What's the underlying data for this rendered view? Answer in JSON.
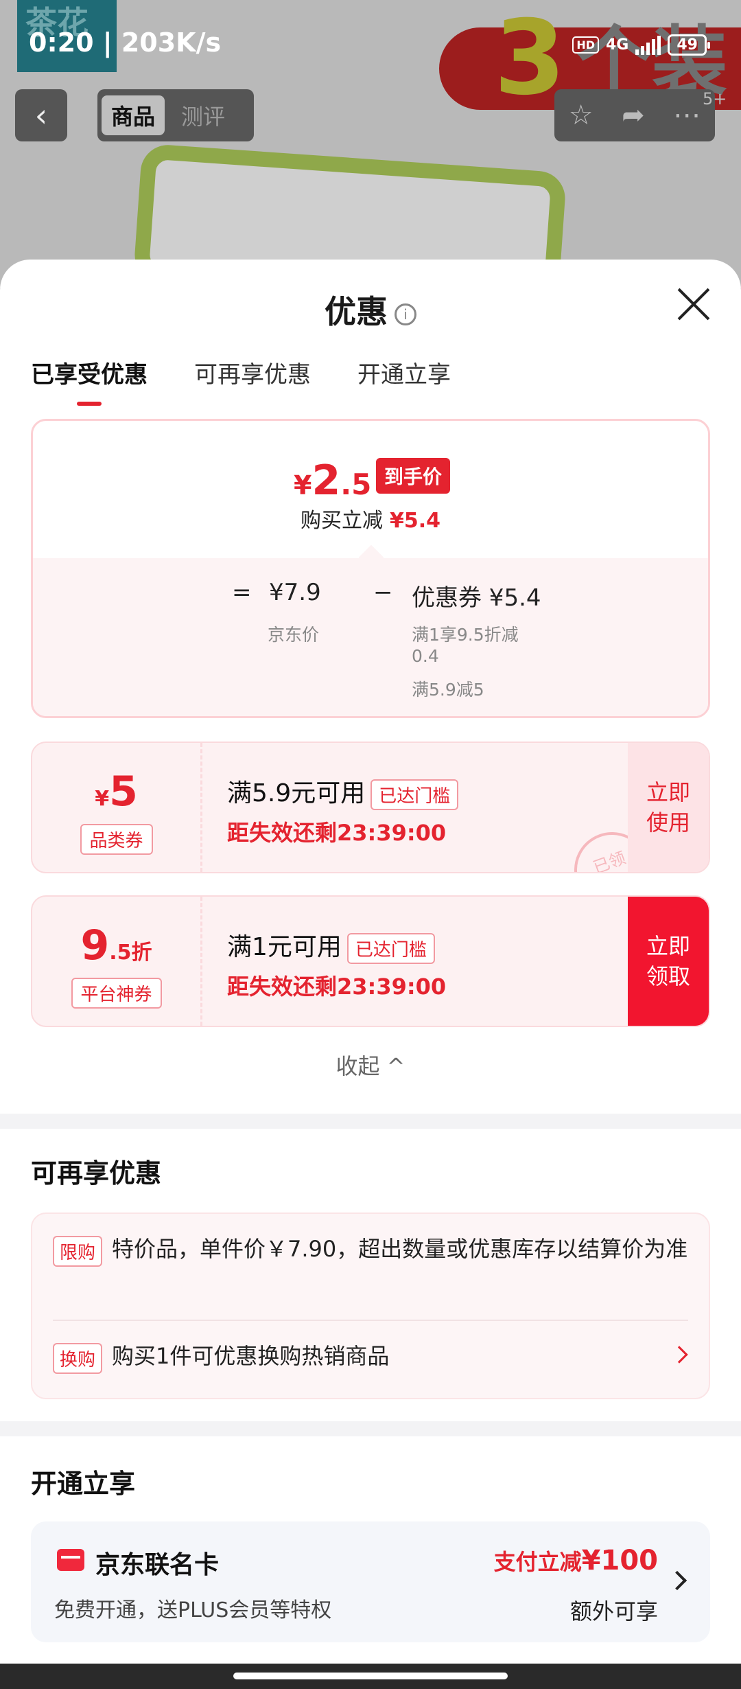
{
  "status_bar": {
    "time": "0:20 | 203K/s",
    "hd": "HD",
    "network": "4G",
    "battery": "49"
  },
  "background": {
    "brand": "茶花",
    "promo_num": "3",
    "promo_text": "个装",
    "cart_count": "5+"
  },
  "nav": {
    "back_icon": "‹",
    "tabs": [
      "商品",
      "测评"
    ]
  },
  "sheet": {
    "title": "优惠",
    "info_icon": "i",
    "tabs": [
      "已享受优惠",
      "可再享优惠",
      "开通立享"
    ],
    "price": {
      "yen": "¥",
      "int": "2",
      "dec": ".5",
      "tag": "到手价",
      "reduce_label": "购买立减",
      "reduce_value": "¥5.4"
    },
    "calc": {
      "eq": "=",
      "jd_price": "¥7.9",
      "minus": "−",
      "coupon": "优惠券 ¥5.4",
      "jd_price_label": "京东价",
      "rule1": "满1享9.5折减",
      "rule1b": "0.4",
      "rule2": "满5.9减5"
    },
    "coupons": [
      {
        "yen": "¥",
        "value": "5",
        "type": "品类券",
        "condition": "满5.9元可用",
        "condition_tag": "已达门槛",
        "expire": "距失效还剩23:39:00",
        "action": "立即使用",
        "action_l1": "立即",
        "action_l2": "使用",
        "stamp": "已领"
      },
      {
        "value": "9",
        "value_dec": ".5折",
        "type": "平台神券",
        "condition": "满1元可用",
        "condition_tag": "已达门槛",
        "expire": "距失效还剩23:39:00",
        "action_l1": "立即",
        "action_l2": "领取"
      }
    ],
    "collapse": "收起 ^",
    "more": {
      "title": "可再享优惠",
      "items": [
        {
          "tag": "限购",
          "text": "特价品，单件价￥7.90，超出数量或优惠库存以结算价为准"
        },
        {
          "tag": "换购",
          "text": "购买1件可优惠换购热销商品"
        }
      ]
    },
    "open": {
      "title": "开通立享",
      "card_name": "京东联名卡",
      "card_desc": "免费开通，送PLUS会员等特权",
      "reduce_label": "支付立减",
      "reduce_value": "¥100",
      "extra": "额外可享"
    }
  }
}
